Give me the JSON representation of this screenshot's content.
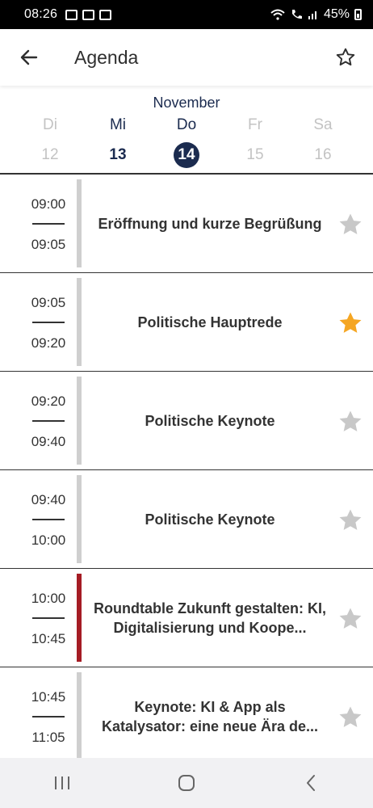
{
  "status_bar": {
    "time": "08:26",
    "battery": "45%"
  },
  "header": {
    "title": "Agenda"
  },
  "date_selector": {
    "month": "November",
    "days": [
      {
        "weekday": "Di",
        "number": "12",
        "state": "disabled"
      },
      {
        "weekday": "Mi",
        "number": "13",
        "state": "enabled"
      },
      {
        "weekday": "Do",
        "number": "14",
        "state": "selected"
      },
      {
        "weekday": "Fr",
        "number": "15",
        "state": "disabled"
      },
      {
        "weekday": "Sa",
        "number": "16",
        "state": "disabled"
      }
    ]
  },
  "sessions": [
    {
      "start": "09:00",
      "end": "09:05",
      "title": "Eröffnung und kurze Begrüßung",
      "favorite": false,
      "accent": false
    },
    {
      "start": "09:05",
      "end": "09:20",
      "title": "Politische Hauptrede",
      "favorite": true,
      "accent": false
    },
    {
      "start": "09:20",
      "end": "09:40",
      "title": "Politische Keynote",
      "favorite": false,
      "accent": false
    },
    {
      "start": "09:40",
      "end": "10:00",
      "title": "Politische Keynote",
      "favorite": false,
      "accent": false
    },
    {
      "start": "10:00",
      "end": "10:45",
      "title": "Roundtable Zukunft gestalten: KI, Digitalisierung und Koope...",
      "favorite": false,
      "accent": true
    },
    {
      "start": "10:45",
      "end": "11:05",
      "title": "Keynote: KI & App als Katalysator: eine neue Ära de...",
      "favorite": false,
      "accent": false
    }
  ],
  "colors": {
    "primary": "#1b2b4f",
    "accent_bar": "#a51c24",
    "star_active": "#f5a623",
    "star_inactive": "#c8c8c8"
  },
  "icons": {
    "back": "arrow-left-icon",
    "favorites": "star-outline-icon",
    "nav_recents": "recents-icon",
    "nav_home": "home-icon",
    "nav_back": "back-icon"
  }
}
